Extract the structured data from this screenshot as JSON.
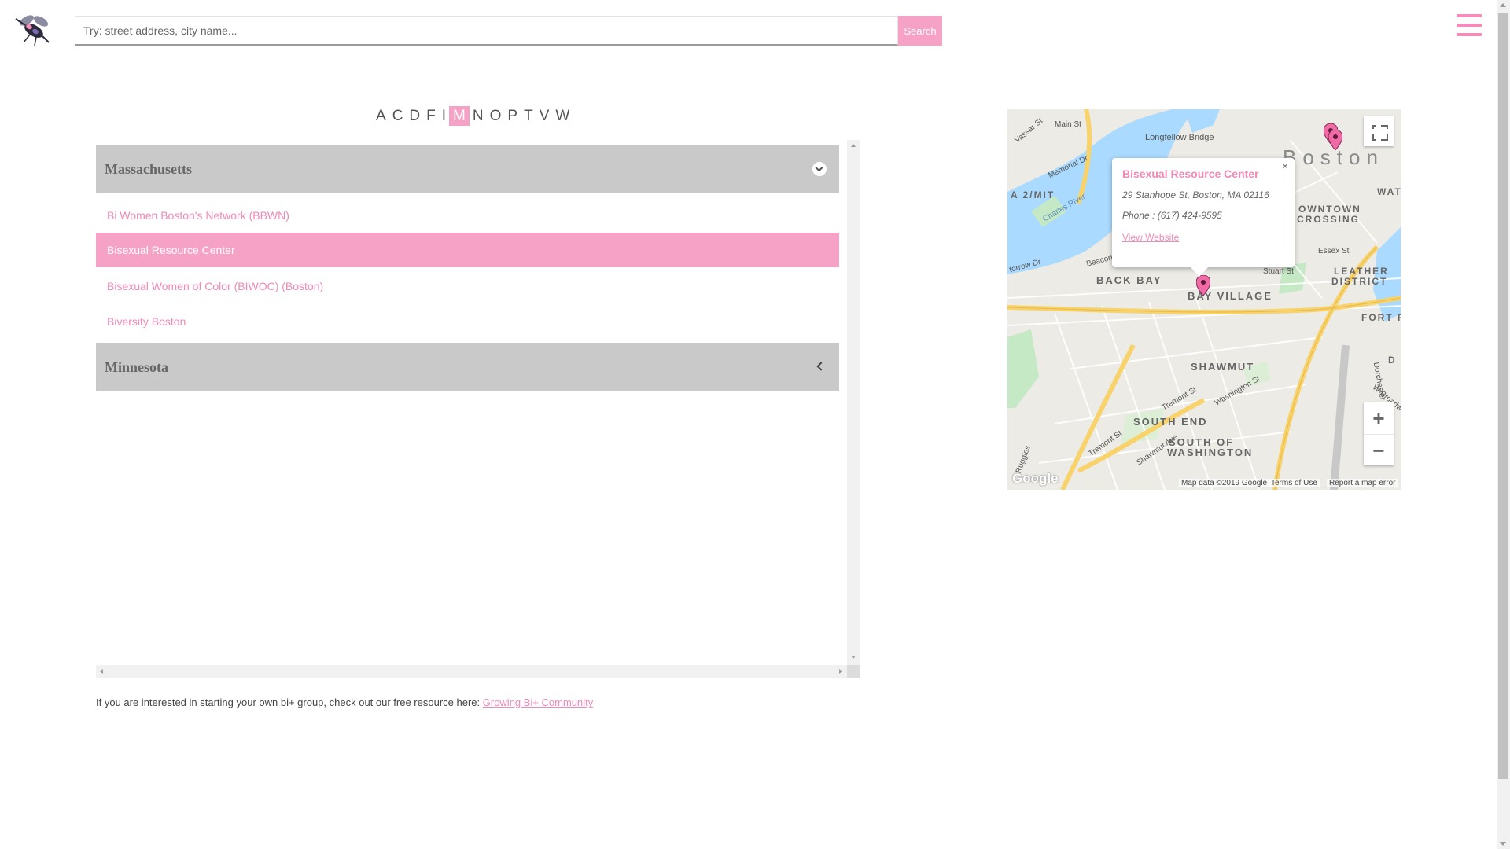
{
  "header": {
    "search_placeholder": "Try: street address, city name...",
    "search_button": "Search"
  },
  "alphabet": {
    "letters": [
      "A",
      "C",
      "D",
      "F",
      "I",
      "M",
      "N",
      "O",
      "P",
      "T",
      "V",
      "W"
    ],
    "active": "M"
  },
  "states": [
    {
      "name": "Massachusetts",
      "expanded": true,
      "groups": [
        {
          "name": "Bi Women Boston's Network (BBWN)",
          "selected": false
        },
        {
          "name": "Bisexual Resource Center",
          "selected": true
        },
        {
          "name": "Bisexual Women of Color (BIWOC) (Boston)",
          "selected": false
        },
        {
          "name": "Biversity Boston",
          "selected": false
        }
      ]
    },
    {
      "name": "Minnesota",
      "expanded": false,
      "groups": []
    }
  ],
  "footer": {
    "text": "If you are interested in starting your own bi+ group, check out our free resource here: ",
    "link": "Growing Bi+ Community"
  },
  "map": {
    "info_window": {
      "title": "Bisexual Resource Center",
      "address": "29 Stanhope St, Boston, MA 02116",
      "phone": "Phone : (617) 424-9595",
      "link": "View Website",
      "close": "×"
    },
    "labels": {
      "boston": "Boston",
      "back_bay": "BACK BAY",
      "bay_village": "BAY VILLAGE",
      "shawmut": "SHAWMUT",
      "south_end": "SOUTH END",
      "south_of_washington_1": "SOUTH OF",
      "south_of_washington_2": "WASHINGTON",
      "leather_district_1": "LEATHER",
      "leather_district_2": "DISTRICT",
      "downtown_crossing_1": "OWNTOWN",
      "downtown_crossing_2": "CROSSING",
      "fort": "FORT P",
      "wate": "WATE",
      "a2mit": "A 2/MIT",
      "charles_river": "Charles River",
      "longfellow": "Longfellow Bridge",
      "memorial": "Memorial Dr",
      "main_st": "Main St",
      "vassar": "Vassar St",
      "beacon": "Beacon St",
      "storrow": "torrow Dr",
      "essex": "Essex St",
      "stuart": "Stuart St",
      "tremont": "Tremont St",
      "washington_st": "Washington St",
      "shawmut_ave": "Shawmut Ave",
      "ruggles": "Ruggles",
      "dorchester": "Dorchester Ave",
      "wbroadway": "W Broadw",
      "d": "D"
    },
    "zoom_in": "+",
    "zoom_out": "−",
    "attribution": {
      "data": "Map data ©2019 Google",
      "terms": "Terms of Use",
      "report": "Report a map error"
    },
    "google": "Google",
    "colors": {
      "pin": "#f06aa5",
      "water": "#aadaff",
      "park": "#c5e8c5",
      "highway": "#f8d36b"
    }
  }
}
